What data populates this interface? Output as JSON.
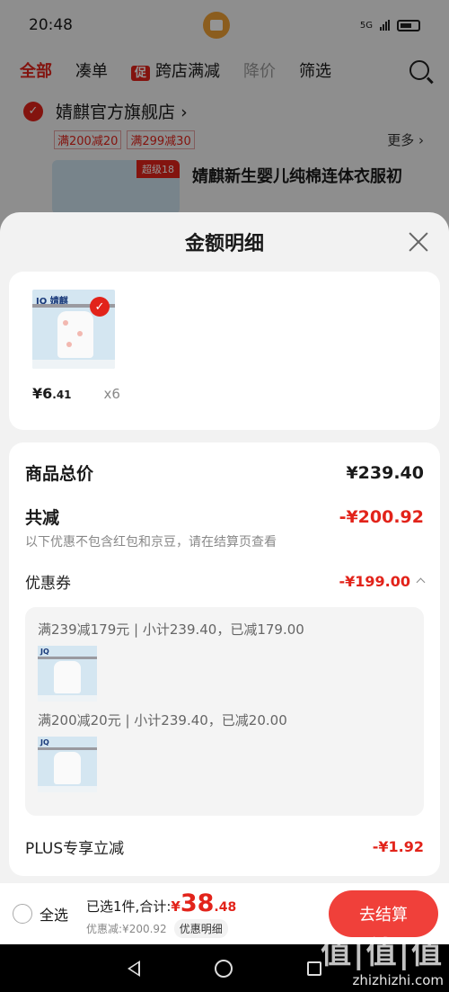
{
  "status_bar": {
    "time": "20:48",
    "network": "5G"
  },
  "top_tabs": {
    "all": "全部",
    "combo": "凑单",
    "promo_badge": "促",
    "cross_store": "跨店满减",
    "price_drop": "降价",
    "filter": "筛选"
  },
  "shop": {
    "name": "婧麒官方旗舰店",
    "name_arrow": "›",
    "promos": [
      "满200减20",
      "满299减30"
    ],
    "more": "更多 ›"
  },
  "product_bg": {
    "title": "婧麒新生婴儿纯棉连体衣服初",
    "badge": "超级18"
  },
  "sheet": {
    "title": "金额明细",
    "goods": {
      "logo": "JQ 婧麒",
      "price_int": "¥6",
      "price_dec": ".41",
      "qty": "x6"
    },
    "total_label": "商品总价",
    "total_value": "¥239.40",
    "discount_label": "共减",
    "discount_value": "-¥200.92",
    "discount_note": "以下优惠不包含红包和京豆，请在结算页查看",
    "coupon_label": "优惠券",
    "coupon_value": "-¥199.00",
    "coupon_items": [
      {
        "text": "满239减179元 | 小计239.40，已减179.00",
        "logo": "JQ"
      },
      {
        "text": "满200减20元 | 小计239.40，已减20.00",
        "logo": "JQ"
      }
    ],
    "plus_label": "PLUS专享立减",
    "plus_value": "-¥1.92"
  },
  "bottom": {
    "select_all": "全选",
    "selected": "已选1件,合计:",
    "yen": "¥",
    "total_int": "38",
    "total_dec": ".48",
    "saved": "优惠减:¥200.92",
    "detail_btn": "优惠明细",
    "checkout": "去结算"
  },
  "watermark": {
    "logo": "值|值|值",
    "site": "zhizhizhi.com"
  },
  "colors": {
    "accent": "#e2231a",
    "checkout": "#f0403a"
  }
}
